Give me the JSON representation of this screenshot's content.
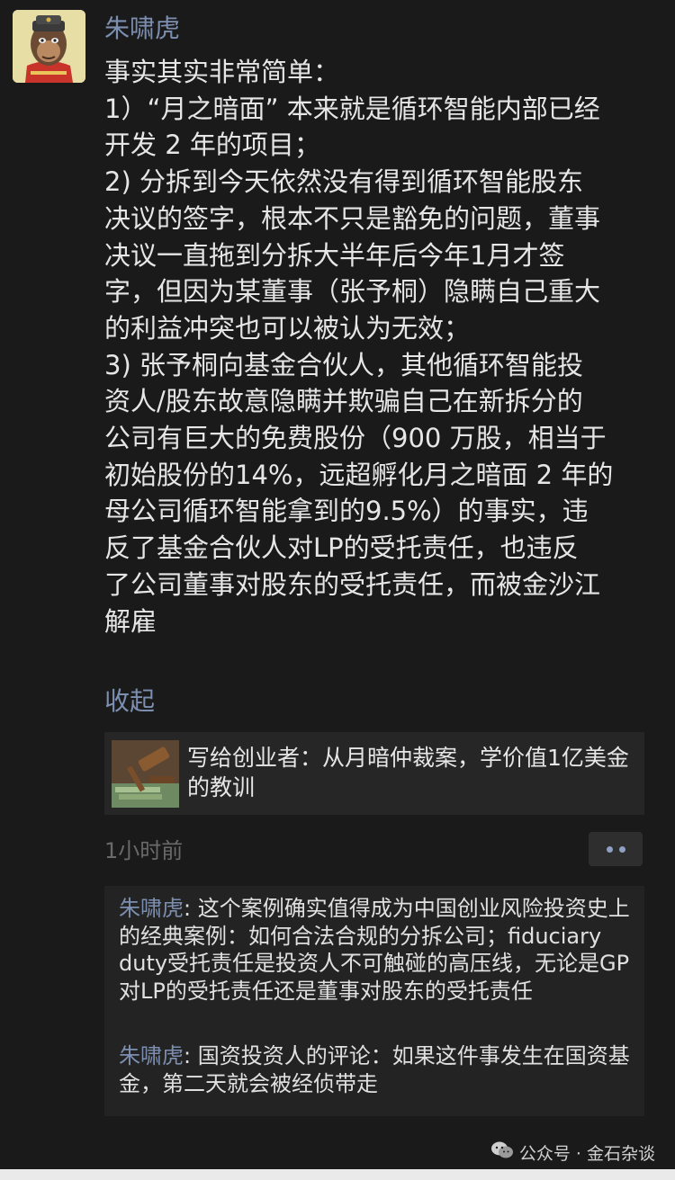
{
  "post": {
    "author": "朱啸虎",
    "lines": [
      "事实其实非常简单：",
      "1）“月之暗面” 本来就是循环智能内部已经",
      "开发 2 年的项目；",
      "2) 分拆到今天依然没有得到循环智能股东",
      "决议的签字，根本不只是豁免的问题，董事",
      "决议一直拖到分拆大半年后今年1月才签",
      "字，但因为某董事（张予桐）隐瞒自己重大",
      "的利益冲突也可以被认为无效；",
      "3) 张予桐向基金合伙人，其他循环智能投",
      "资人/股东故意隐瞒并欺骗自己在新拆分的",
      "公司有巨大的免费股份（900 万股，相当于",
      "初始股份的14%，远超孵化月之暗面 2 年的",
      "母公司循环智能拿到的9.5%）的事实，违",
      "反了基金合伙人对LP的受托责任，也违反",
      "了公司董事对股东的受托责任，而被金沙江",
      "解雇"
    ],
    "collapse_label": "收起",
    "link": {
      "title": "写给创业者：从月暗仲裁案，学价值1亿美金的教训"
    },
    "time": "1小时前"
  },
  "comments": [
    {
      "author": "朱啸虎",
      "text": ": 这个案例确实值得成为中国创业风险投资史上的经典案例：如何合法合规的分拆公司；fiduciary duty受托责任是投资人不可触碰的高压线，无论是GP对LP的受托责任还是董事对股东的受托责任"
    },
    {
      "author": "朱啸虎",
      "text": ": 国资投资人的评论：如果这件事发生在国资基金，第二天就会被经侦带走"
    }
  ],
  "watermark": {
    "text": "公众号 · 金石杂谈"
  },
  "colors": {
    "background": "#1a1a1a",
    "name_blue": "#7d8fb0",
    "text": "#e6e6e6"
  }
}
